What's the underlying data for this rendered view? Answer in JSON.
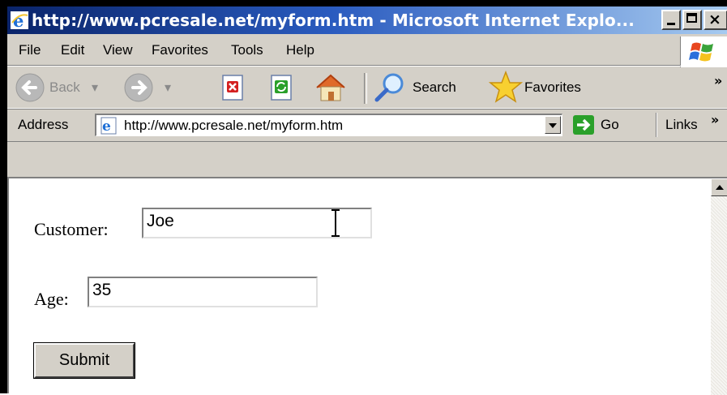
{
  "window": {
    "title": "http://www.pcresale.net/myform.htm - Microsoft Internet Explo...",
    "title_color": "#ffffff",
    "titlebar_color": "#0a246a"
  },
  "menu": {
    "items": [
      "File",
      "Edit",
      "View",
      "Favorites",
      "Tools",
      "Help"
    ]
  },
  "toolbar": {
    "back_label": "Back",
    "search_label": "Search",
    "favorites_label": "Favorites",
    "overflow": "»",
    "icons": [
      "back-arrow-icon",
      "forward-arrow-icon",
      "stop-icon",
      "refresh-icon",
      "home-icon",
      "search-icon",
      "favorites-star-icon"
    ]
  },
  "address": {
    "label": "Address",
    "url": "http://www.pcresale.net/myform.htm",
    "go_label": "Go",
    "links_label": "Links",
    "links_overflow": "»"
  },
  "form": {
    "customer_label": "Customer:",
    "customer_value": "Joe",
    "age_label": "Age:",
    "age_value": "35",
    "submit_label": "Submit"
  }
}
